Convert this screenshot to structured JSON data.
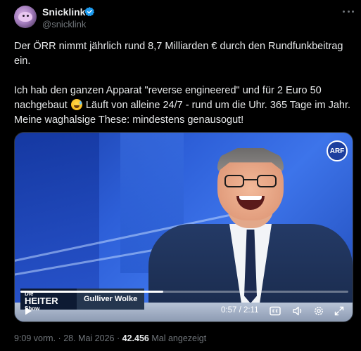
{
  "author": {
    "name": "Snicklink",
    "handle": "@snicklink",
    "verified": true,
    "avatar_icon": "avatar-blob-creature"
  },
  "tweet": {
    "paragraph1": "Der ÖRR nimmt jährlich rund 8,7 Milliarden € durch den Rundfunkbeitrag ein.",
    "paragraph2_part1": "Ich hab den ganzen Apparat \"reverse engineered\" und für 2 Euro 50 nachgebaut",
    "paragraph2_part2": "Läuft von alleine 24/7 - rund um die Uhr. 365 Tage im Jahr. Meine waghalsige These: mindestens genausogut!",
    "emoji_icon": "grinning-sweat-emoji"
  },
  "video": {
    "channel_logo": "ARF",
    "show_logo_line1": "Die",
    "show_logo_line2": "HEITER",
    "show_logo_line3": "Show",
    "lower_third_name": "Gulliver Wolke",
    "time_display": "0:57 / 2:11",
    "progress_fraction": 0.435,
    "icons": [
      "play-icon",
      "captions-icon",
      "volume-icon",
      "settings-icon",
      "fullscreen-icon"
    ]
  },
  "meta": {
    "time": "9:09 vorm.",
    "separator": "·",
    "date": "28. Mai 2026",
    "views": "42.456",
    "views_label": "Mal angezeigt"
  },
  "colors": {
    "background": "#000000",
    "text": "#e7e9ea",
    "secondary": "#71767b",
    "verified": "#1d9bf0"
  }
}
